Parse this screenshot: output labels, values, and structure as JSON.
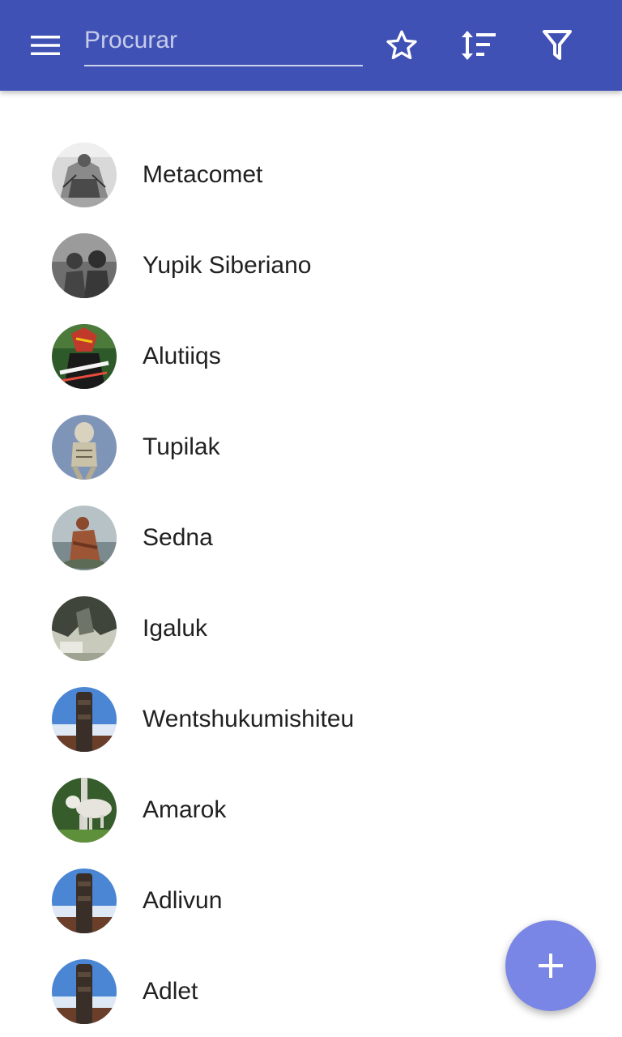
{
  "app_bar": {
    "background_color": "#3f51b5",
    "menu_icon": "hamburger-menu-icon",
    "search": {
      "placeholder": "Procurar",
      "value": ""
    },
    "actions": [
      {
        "name": "favorites",
        "icon": "star-outline-icon"
      },
      {
        "name": "sort",
        "icon": "sort-icon"
      },
      {
        "name": "filter",
        "icon": "filter-icon"
      }
    ]
  },
  "list": {
    "items": [
      {
        "label": "Metacomet",
        "avatar": "engraving-portrait"
      },
      {
        "label": "Yupik Siberiano",
        "avatar": "bw-photo-people"
      },
      {
        "label": "Alutiiqs",
        "avatar": "costume-dancer"
      },
      {
        "label": "Tupilak",
        "avatar": "carved-figure"
      },
      {
        "label": "Sedna",
        "avatar": "sea-statue"
      },
      {
        "label": "Igaluk",
        "avatar": "rock-carving"
      },
      {
        "label": "Wentshukumishiteu",
        "avatar": "totem-sky"
      },
      {
        "label": "Amarok",
        "avatar": "wolf-forest"
      },
      {
        "label": "Adlivun",
        "avatar": "totem-sky"
      },
      {
        "label": "Adlet",
        "avatar": "totem-sky"
      }
    ]
  },
  "fab": {
    "icon": "plus-icon",
    "color": "#7986e5"
  }
}
